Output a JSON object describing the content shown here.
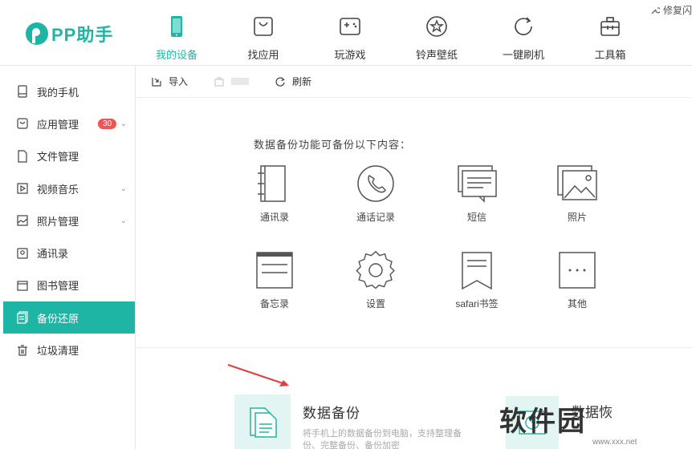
{
  "app": {
    "logo_text": "PP助手",
    "top_right_label": "修复闪"
  },
  "nav": [
    {
      "label": "我的设备",
      "icon": "phone-icon",
      "active": true
    },
    {
      "label": "找应用",
      "icon": "shopping-bag-icon",
      "active": false
    },
    {
      "label": "玩游戏",
      "icon": "gamepad-icon",
      "active": false
    },
    {
      "label": "铃声壁纸",
      "icon": "star-icon",
      "active": false
    },
    {
      "label": "一键刷机",
      "icon": "refresh-icon",
      "active": false
    },
    {
      "label": "工具箱",
      "icon": "toolbox-icon",
      "active": false
    }
  ],
  "sidebar": {
    "items": [
      {
        "label": "我的手机",
        "icon": "phone-outline-icon"
      },
      {
        "label": "应用管理",
        "icon": "app-icon",
        "badge": "30",
        "expandable": true
      },
      {
        "label": "文件管理",
        "icon": "file-icon"
      },
      {
        "label": "视频音乐",
        "icon": "play-icon",
        "expandable": true
      },
      {
        "label": "照片管理",
        "icon": "photo-icon",
        "expandable": true
      },
      {
        "label": "通讯录",
        "icon": "contacts-icon"
      },
      {
        "label": "图书管理",
        "icon": "book-icon"
      },
      {
        "label": "备份还原",
        "icon": "backup-icon",
        "active": true
      },
      {
        "label": "垃圾清理",
        "icon": "trash-icon"
      }
    ]
  },
  "toolbar": {
    "import_label": "导入",
    "disabled_label": "",
    "refresh_label": "刷新"
  },
  "main": {
    "title": "数据备份功能可备份以下内容：",
    "items": [
      {
        "label": "通讯录",
        "icon": "address-book-icon"
      },
      {
        "label": "通话记录",
        "icon": "call-log-icon"
      },
      {
        "label": "短信",
        "icon": "sms-icon"
      },
      {
        "label": "照片",
        "icon": "photos-icon"
      },
      {
        "label": "备忘录",
        "icon": "memo-icon"
      },
      {
        "label": "设置",
        "icon": "settings-gear-icon"
      },
      {
        "label": "safari书签",
        "icon": "bookmark-icon"
      },
      {
        "label": "其他",
        "icon": "more-icon"
      }
    ],
    "backup_card": {
      "title": "数据备份",
      "desc": "将手机上的数据备份到电脑，支持整理备份、完整备份、备份加密"
    },
    "restore_card": {
      "title": "数据恢"
    }
  },
  "watermark": {
    "text": "软件园",
    "sub": "www.xxx.net"
  },
  "colors": {
    "accent": "#1fb5a4",
    "badge": "#f05454",
    "arrow": "#e0403a"
  }
}
